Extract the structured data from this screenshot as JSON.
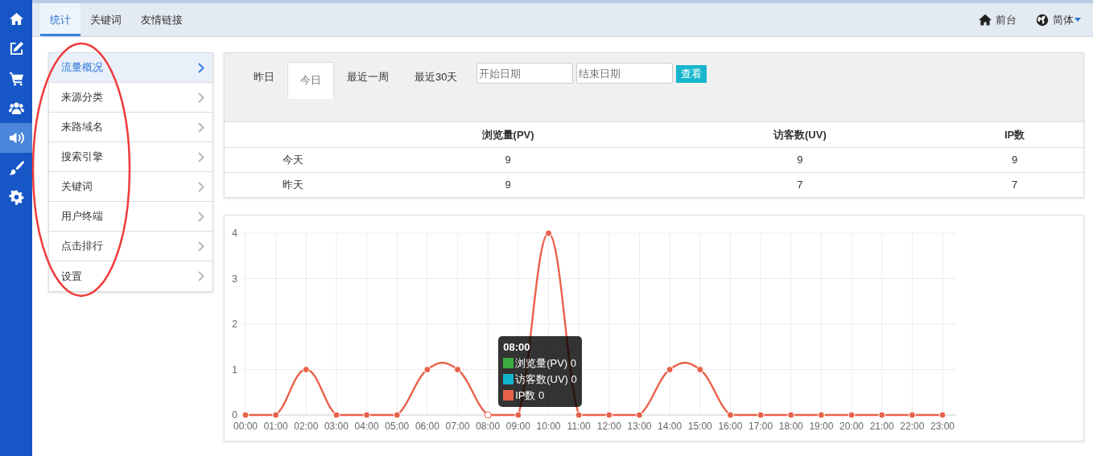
{
  "sidebar": {
    "items": [
      {
        "kind": "home",
        "selected": false
      },
      {
        "kind": "edit",
        "selected": false
      },
      {
        "kind": "cart",
        "selected": false
      },
      {
        "kind": "users",
        "selected": false
      },
      {
        "kind": "volume",
        "selected": true
      },
      {
        "kind": "brush",
        "selected": false
      },
      {
        "kind": "gear",
        "selected": false
      }
    ]
  },
  "top_tabs": [
    {
      "label": "统计",
      "selected": true
    },
    {
      "label": "关键词",
      "selected": false
    },
    {
      "label": "友情链接",
      "selected": false
    }
  ],
  "top_right": [
    {
      "kind": "home",
      "label": "前台"
    },
    {
      "kind": "language",
      "label": "简体"
    }
  ],
  "menu": [
    {
      "label": "流量概况",
      "selected": true
    },
    {
      "label": "来源分类",
      "selected": false
    },
    {
      "label": "来路域名",
      "selected": false
    },
    {
      "label": "搜索引擎",
      "selected": false
    },
    {
      "label": "关键词",
      "selected": false
    },
    {
      "label": "用户终端",
      "selected": false
    },
    {
      "label": "点击排行",
      "selected": false
    },
    {
      "label": "设置",
      "selected": false
    }
  ],
  "periods": [
    {
      "label": "昨日",
      "selected": false
    },
    {
      "label": "今日",
      "selected": true
    },
    {
      "label": "最近一周",
      "selected": false
    },
    {
      "label": "最近30天",
      "selected": false
    }
  ],
  "start_date": {
    "placeholder": "开始日期"
  },
  "end_date": {
    "placeholder": "结束日期"
  },
  "view_button": "查看",
  "table": {
    "columns": [
      "浏览量(PV)",
      "访客数(UV)",
      "IP数"
    ],
    "rows": [
      {
        "label": "今天",
        "cells": [
          "9",
          "9",
          "9"
        ]
      },
      {
        "label": "昨天",
        "cells": [
          "9",
          "7",
          "7"
        ]
      }
    ]
  },
  "chart": {
    "chart_data": {
      "type": "line",
      "grid": true,
      "categories": [
        "00:00",
        "01:00",
        "02:00",
        "03:00",
        "04:00",
        "05:00",
        "06:00",
        "07:00",
        "08:00",
        "09:00",
        "10:00",
        "11:00",
        "12:00",
        "13:00",
        "14:00",
        "15:00",
        "16:00",
        "17:00",
        "18:00",
        "19:00",
        "20:00",
        "21:00",
        "22:00",
        "23:00"
      ],
      "ylim": [
        0,
        4
      ],
      "yticks": [
        0,
        1,
        2,
        3,
        4
      ],
      "series": [
        {
          "color": "#e9614a",
          "marker": true,
          "values": [
            0,
            0,
            1,
            0,
            0,
            0,
            1,
            1,
            0,
            0,
            4,
            0,
            0,
            0,
            1,
            1,
            0,
            0,
            0,
            0,
            0,
            0,
            0,
            0
          ]
        }
      ]
    },
    "tooltip": {
      "title": "08:00",
      "items": [
        {
          "text": "浏览量(PV) 0",
          "color": "#3bab3f"
        },
        {
          "text": "访客数(UV) 0",
          "color": "#12b5cb"
        },
        {
          "text": "IP数 0",
          "color": "#e9614a"
        }
      ]
    }
  },
  "annotations": [
    {
      "kind": "ellipse",
      "color": "#ef3b3b"
    }
  ]
}
